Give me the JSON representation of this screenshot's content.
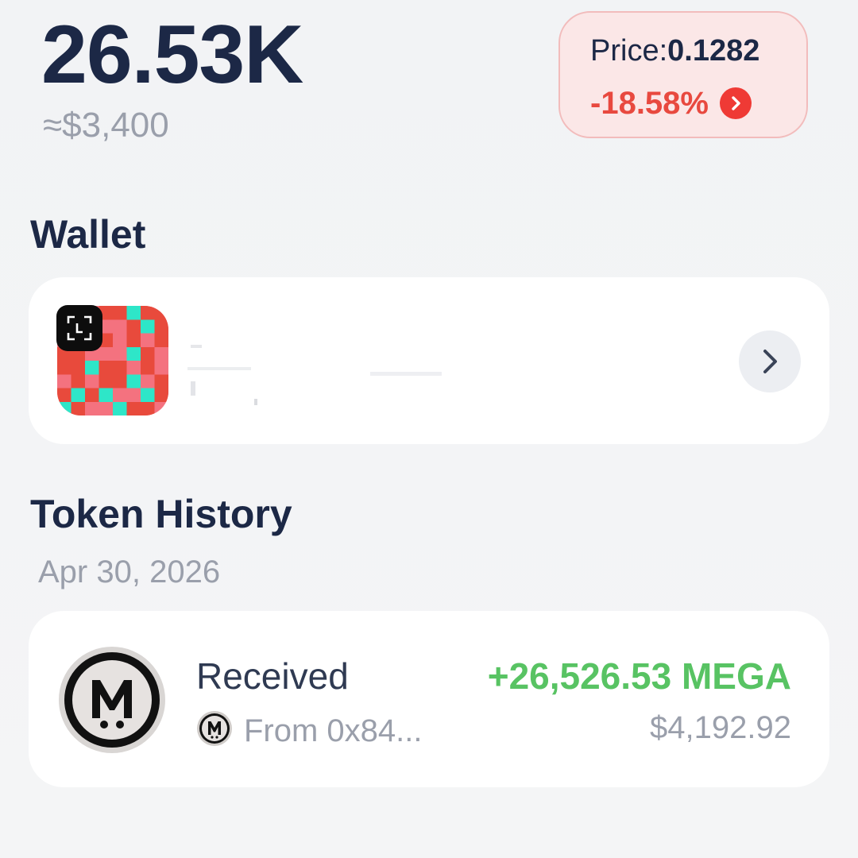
{
  "balance": {
    "amount": "26.53K",
    "fiat": "≈$3,400"
  },
  "price": {
    "label": "Price:",
    "value": "0.1282",
    "change": "-18.58%",
    "change_icon": "chevron-right-icon",
    "down_color": "#e8493f"
  },
  "wallet": {
    "title": "Wallet",
    "avatar_icon": "wallet-identicon",
    "badge_icon": "scan-icon",
    "action_icon": "chevron-right-icon"
  },
  "history": {
    "title": "Token History",
    "groups": [
      {
        "date": "Apr 30, 2026",
        "items": [
          {
            "type": "Received",
            "from": "From 0x84...",
            "amount": "+26,526.53 MEGA",
            "value": "$4,192.92",
            "token_icon": "mega-token-icon",
            "amount_color": "#58c363"
          }
        ]
      }
    ]
  },
  "colors": {
    "text_primary": "#1c2846",
    "text_muted": "#9a9fab",
    "negative": "#e8493f",
    "positive": "#58c363",
    "price_card_bg": "#fbe7e7"
  }
}
